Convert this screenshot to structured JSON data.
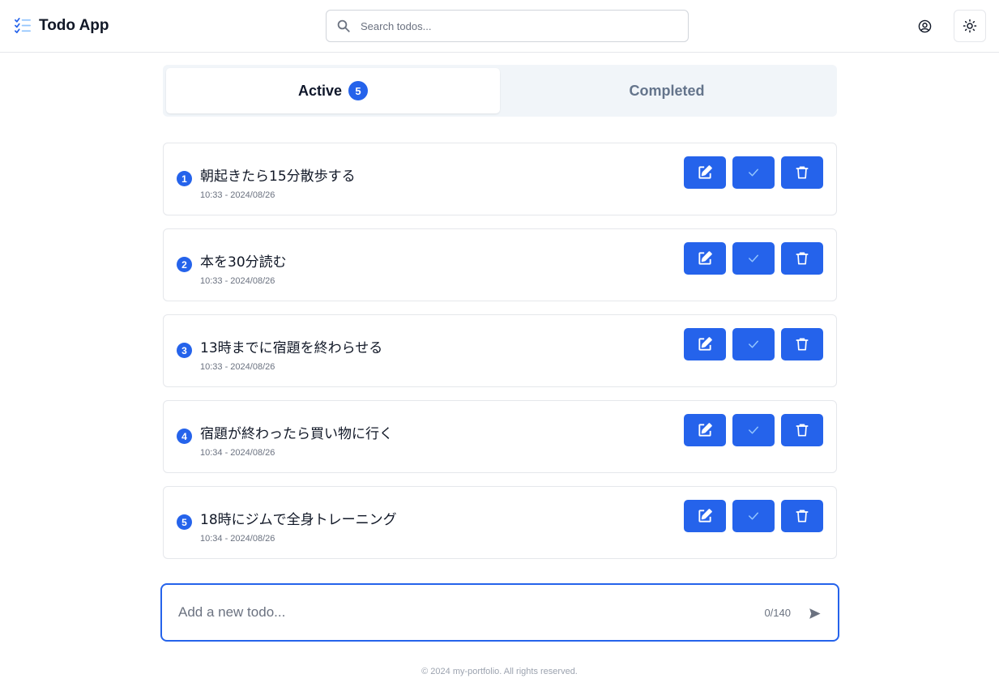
{
  "header": {
    "title": "Todo App",
    "search_placeholder": "Search todos..."
  },
  "tabs": [
    {
      "label": "Active",
      "count": "5"
    },
    {
      "label": "Completed"
    }
  ],
  "todos": [
    {
      "number": "1",
      "text": "朝起きたら15分散歩する",
      "time": "10:33 - 2024/08/26"
    },
    {
      "number": "2",
      "text": "本を30分読む",
      "time": "10:33 - 2024/08/26"
    },
    {
      "number": "3",
      "text": "13時までに宿題を終わらせる",
      "time": "10:33 - 2024/08/26"
    },
    {
      "number": "4",
      "text": "宿題が終わったら買い物に行く",
      "time": "10:34 - 2024/08/26"
    },
    {
      "number": "5",
      "text": "18時にジムで全身トレーニング",
      "time": "10:34 - 2024/08/26"
    }
  ],
  "new_todo": {
    "placeholder": "Add a new todo...",
    "char_count": "0/140"
  },
  "footer": {
    "text": "© 2024 my-portfolio. All rights reserved."
  },
  "colors": {
    "accent": "#2563eb",
    "border": "#e5e7eb",
    "tab_bg": "#f1f5f9"
  },
  "icons": {
    "brand": "checklist-icon",
    "search": "search-icon",
    "user": "user-circle-icon",
    "theme": "sun-icon",
    "edit": "edit-icon",
    "complete": "check-icon",
    "delete": "trash-icon",
    "send": "send-icon"
  }
}
